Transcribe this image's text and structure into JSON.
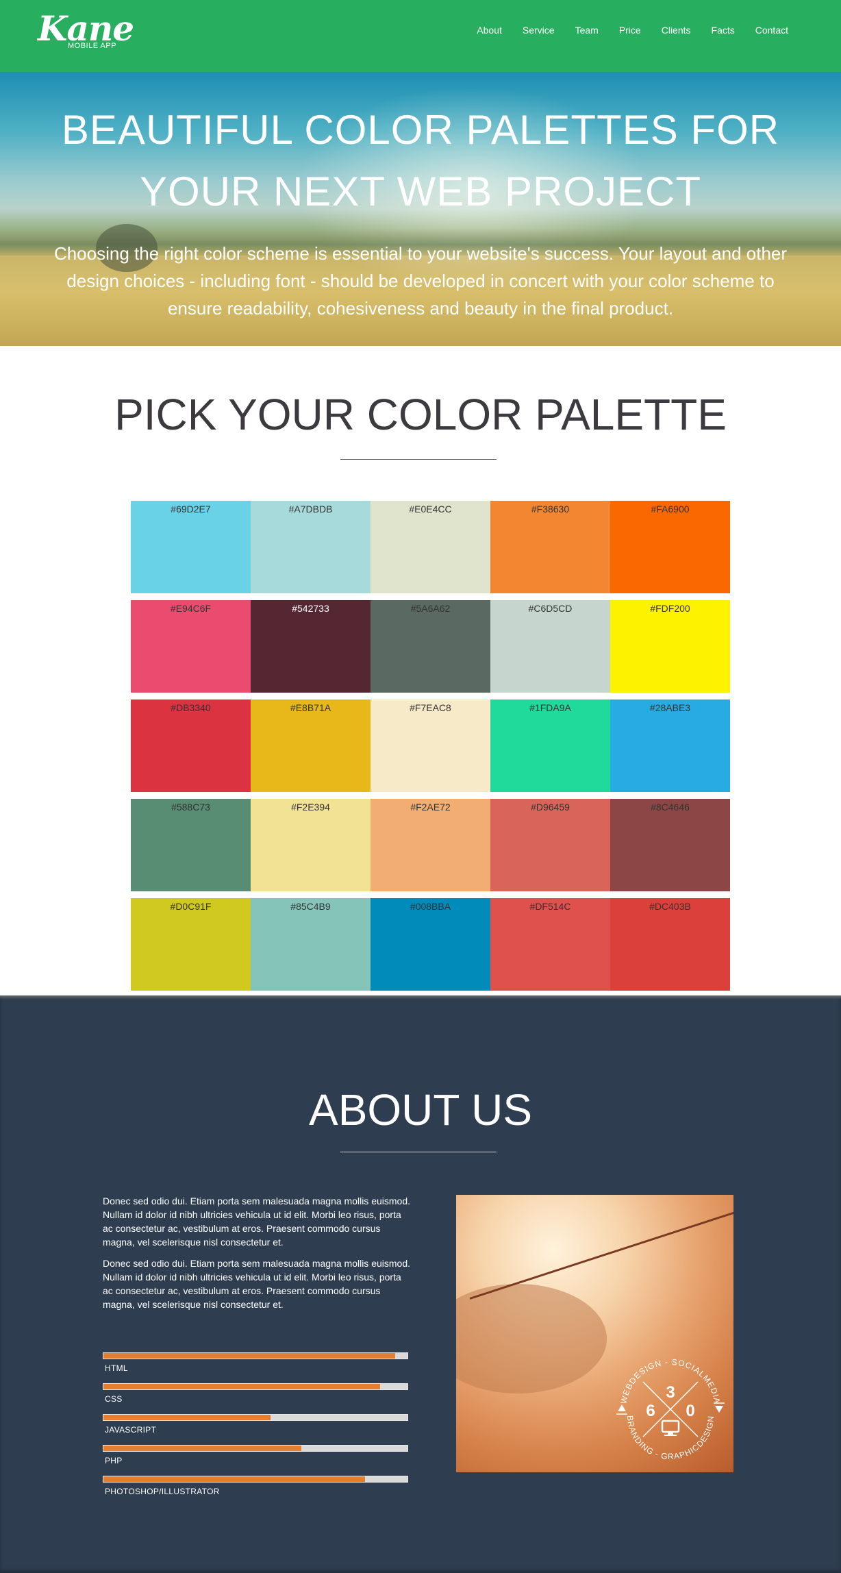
{
  "nav": {
    "logo_script": "Kane",
    "logo_sub": "MOBILE APP",
    "links": [
      "About",
      "Service",
      "Team",
      "Price",
      "Clients",
      "Facts",
      "Contact"
    ]
  },
  "hero": {
    "title_line1": "BEAUTIFUL COLOR PALETTES FOR",
    "title_line2": "YOUR NEXT WEB PROJECT",
    "text": "Choosing the right color scheme is essential to your website's success. Your layout and other design choices - including font - should be developed in concert with your color scheme to ensure readability, cohesiveness and beauty in the final product."
  },
  "palette": {
    "title": "PICK YOUR COLOR PALETTE",
    "rows": [
      [
        {
          "hex": "#69D2E7",
          "label": "#69D2E7",
          "text": "dk"
        },
        {
          "hex": "#A7DBDB",
          "label": "#A7DBDB",
          "text": "dk"
        },
        {
          "hex": "#E0E4CC",
          "label": "#E0E4CC",
          "text": "dk"
        },
        {
          "hex": "#F38630",
          "label": "#F38630",
          "text": "dk"
        },
        {
          "hex": "#FA6900",
          "label": "#FA6900",
          "text": "dk"
        }
      ],
      [
        {
          "hex": "#E94C6F",
          "label": "#E94C6F",
          "text": "dk"
        },
        {
          "hex": "#542733",
          "label": "#542733",
          "text": "lt"
        },
        {
          "hex": "#5A6A62",
          "label": "#5A6A62",
          "text": "dk"
        },
        {
          "hex": "#C6D5CD",
          "label": "#C6D5CD",
          "text": "dk"
        },
        {
          "hex": "#FDF200",
          "label": "#FDF200",
          "text": "dk"
        }
      ],
      [
        {
          "hex": "#DB3340",
          "label": "#DB3340",
          "text": "dk"
        },
        {
          "hex": "#E8B71A",
          "label": "#E8B71A",
          "text": "dk"
        },
        {
          "hex": "#F7EAC8",
          "label": "#F7EAC8",
          "text": "dk"
        },
        {
          "hex": "#1FDA9A",
          "label": "#1FDA9A",
          "text": "dk"
        },
        {
          "hex": "#28ABE3",
          "label": "#28ABE3",
          "text": "dk"
        }
      ],
      [
        {
          "hex": "#588C73",
          "label": "#588C73",
          "text": "dk"
        },
        {
          "hex": "#F2E394",
          "label": "#F2E394",
          "text": "dk"
        },
        {
          "hex": "#F2AE72",
          "label": "#F2AE72",
          "text": "dk"
        },
        {
          "hex": "#D96459",
          "label": "#D96459",
          "text": "dk"
        },
        {
          "hex": "#8C4646",
          "label": "#8C4646",
          "text": "dk"
        }
      ],
      [
        {
          "hex": "#D0C91F",
          "label": "#D0C91F",
          "text": "dk"
        },
        {
          "hex": "#85C4B9",
          "label": "#85C4B9",
          "text": "dk"
        },
        {
          "hex": "#008BBA",
          "label": "#008BBA",
          "text": "dk"
        },
        {
          "hex": "#DF514C",
          "label": "#DF514C",
          "text": "dk"
        },
        {
          "hex": "#DC403B",
          "label": "#DC403B",
          "text": "dk"
        }
      ]
    ]
  },
  "about": {
    "title": "ABOUT US",
    "p1": "Donec sed odio dui. Etiam porta sem malesuada magna mollis euismod. Nullam id dolor id nibh ultricies vehicula ut id elit. Morbi leo risus, porta ac consectetur ac, vestibulum at eros. Praesent commodo cursus magna, vel scelerisque nisl consectetur et.",
    "p2": "Donec sed odio dui. Etiam porta sem malesuada magna mollis euismod. Nullam id dolor id nibh ultricies vehicula ut id elit. Morbi leo risus, porta ac consectetur ac, vestibulum at eros. Praesent commodo cursus magna, vel scelerisque nisl consectetur et.",
    "skills": [
      {
        "name": "HTML",
        "level": 0.96
      },
      {
        "name": "CSS",
        "level": 0.91
      },
      {
        "name": "JAVASCRIPT",
        "level": 0.55
      },
      {
        "name": "PHP",
        "level": 0.65
      },
      {
        "name": "PHOTOSHOP/ILLUSTRATOR",
        "level": 0.86
      }
    ],
    "badge": {
      "top_arc": "WEBDESIGN - SOCIALMEDIA",
      "bottom_arc": "BRANDING - GRAPHICDESIGN",
      "d1": "3",
      "d2": "6",
      "d3": "0"
    }
  },
  "colors": {
    "nav_bg": "#27AE5F",
    "about_bg": "#2E3D50",
    "skill_fill": "#E47F32"
  }
}
